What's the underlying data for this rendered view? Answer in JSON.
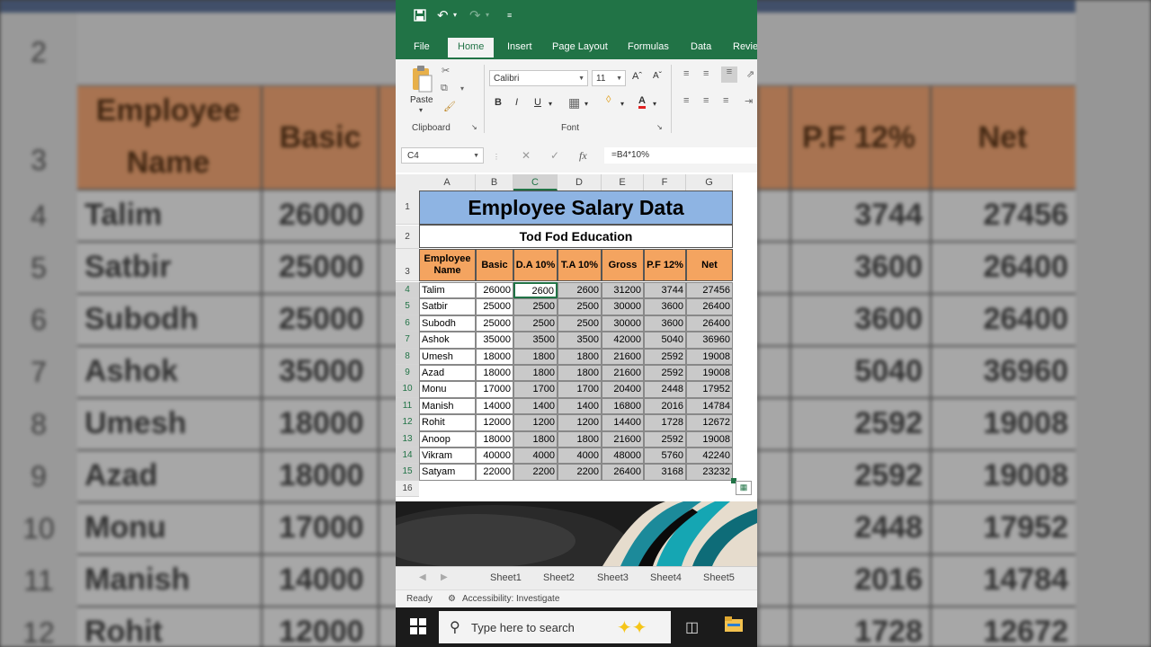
{
  "ribbon": {
    "tabs": [
      "File",
      "Home",
      "Insert",
      "Page Layout",
      "Formulas",
      "Data",
      "Revie"
    ],
    "active_tab": "Home",
    "paste_label": "Paste",
    "font_name": "Calibri",
    "font_size": "11",
    "bold": "B",
    "italic": "I",
    "underline": "U",
    "groups": {
      "clipboard": "Clipboard",
      "font": "Font"
    }
  },
  "formula_bar": {
    "name_box": "C4",
    "fx_label": "fx",
    "formula": "=B4*10%"
  },
  "sheet": {
    "columns": [
      "A",
      "B",
      "C",
      "D",
      "E",
      "F",
      "G"
    ],
    "selected_column": "C",
    "rows": [
      "1",
      "2",
      "3",
      "4",
      "5",
      "6",
      "7",
      "8",
      "9",
      "10",
      "11",
      "12",
      "13",
      "14",
      "15",
      "16"
    ],
    "title": "Employee Salary Data",
    "subtitle": "Tod Fod Education",
    "headers": [
      "Employee Name",
      "Basic",
      "D.A 10%",
      "T.A 10%",
      "Gross",
      "P.F 12%",
      "Net"
    ],
    "data": [
      [
        "Talim",
        "26000",
        "2600",
        "2600",
        "31200",
        "3744",
        "27456"
      ],
      [
        "Satbir",
        "25000",
        "2500",
        "2500",
        "30000",
        "3600",
        "26400"
      ],
      [
        "Subodh",
        "25000",
        "2500",
        "2500",
        "30000",
        "3600",
        "26400"
      ],
      [
        "Ashok",
        "35000",
        "3500",
        "3500",
        "42000",
        "5040",
        "36960"
      ],
      [
        "Umesh",
        "18000",
        "1800",
        "1800",
        "21600",
        "2592",
        "19008"
      ],
      [
        "Azad",
        "18000",
        "1800",
        "1800",
        "21600",
        "2592",
        "19008"
      ],
      [
        "Monu",
        "17000",
        "1700",
        "1700",
        "20400",
        "2448",
        "17952"
      ],
      [
        "Manish",
        "14000",
        "1400",
        "1400",
        "16800",
        "2016",
        "14784"
      ],
      [
        "Rohit",
        "12000",
        "1200",
        "1200",
        "14400",
        "1728",
        "12672"
      ],
      [
        "Anoop",
        "18000",
        "1800",
        "1800",
        "21600",
        "2592",
        "19008"
      ],
      [
        "Vikram",
        "40000",
        "4000",
        "4000",
        "48000",
        "5760",
        "42240"
      ],
      [
        "Satyam",
        "22000",
        "2200",
        "2200",
        "26400",
        "3168",
        "23232"
      ]
    ]
  },
  "sheet_tabs": [
    "Sheet1",
    "Sheet2",
    "Sheet3",
    "Sheet4",
    "Sheet5"
  ],
  "status_bar": {
    "ready": "Ready",
    "accessibility": "Accessibility: Investigate"
  },
  "taskbar": {
    "search_placeholder": "Type here to search"
  },
  "background": {
    "row_numbers": [
      "2",
      "3",
      "4",
      "5",
      "6",
      "7",
      "8",
      "9",
      "10",
      "11",
      "12"
    ],
    "header_left": [
      "Employee",
      "Name"
    ],
    "header_basic": "Basic",
    "header_pf": "P.F 12%",
    "header_net": "Net",
    "names": [
      "Talim",
      "Satbir",
      "Subodh",
      "Ashok",
      "Umesh",
      "Azad",
      "Monu",
      "Manish",
      "Rohit"
    ],
    "basic": [
      "26000",
      "25000",
      "25000",
      "35000",
      "18000",
      "18000",
      "17000",
      "14000",
      "12000"
    ],
    "pf": [
      "3744",
      "3600",
      "3600",
      "5040",
      "2592",
      "2592",
      "2448",
      "2016",
      "1728"
    ],
    "net": [
      "27456",
      "26400",
      "26400",
      "36960",
      "19008",
      "19008",
      "17952",
      "14784",
      "12672"
    ]
  },
  "colors": {
    "excel_green": "#217346",
    "title_fill": "#8eb4e3",
    "header_fill": "#f4a460",
    "selection_fill": "#c9c9c9"
  }
}
